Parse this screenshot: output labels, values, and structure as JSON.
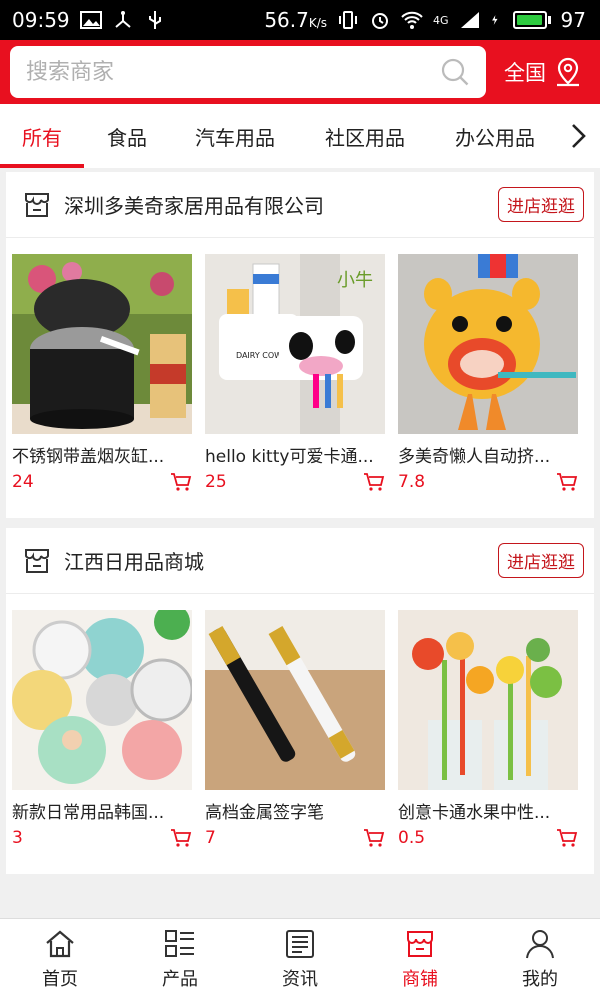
{
  "status_bar": {
    "time": "09:59",
    "speed": "56.7",
    "speed_unit": "K/s",
    "network": "4G",
    "battery": "97",
    "battery_level": 0.97
  },
  "search": {
    "placeholder": "搜索商家"
  },
  "region": {
    "label": "全国"
  },
  "tabs": [
    {
      "label": "所有",
      "active": true
    },
    {
      "label": "食品"
    },
    {
      "label": "汽车用品"
    },
    {
      "label": "社区用品"
    },
    {
      "label": "办公用品"
    }
  ],
  "shops": [
    {
      "name": "深圳多美奇家居用品有限公司",
      "enter_label": "进店逛逛",
      "products": [
        {
          "name": "不锈钢带盖烟灰缸...",
          "price": "24",
          "image": "ashtray"
        },
        {
          "name": "hello kitty可爱卡通...",
          "price": "25",
          "image": "toothbrush-holder",
          "image_text": {
            "brand": "DAIRY COW",
            "tag": "小牛"
          }
        },
        {
          "name": "多美奇懒人自动挤...",
          "price": "7.8",
          "image": "tiger-toothpaste-squeezer"
        }
      ]
    },
    {
      "name": "江西日用品商城",
      "enter_label": "进店逛逛",
      "products": [
        {
          "name": "新款日常用品韩国...",
          "price": "3",
          "image": "compact-mirrors"
        },
        {
          "name": "高档金属签字笔",
          "price": "7",
          "image": "metal-pens"
        },
        {
          "name": "创意卡通水果中性...",
          "price": "0.5",
          "image": "fruit-pens"
        }
      ]
    }
  ],
  "bottom_nav": [
    {
      "label": "首页",
      "icon": "home-icon"
    },
    {
      "label": "产品",
      "icon": "list-icon"
    },
    {
      "label": "资讯",
      "icon": "news-icon"
    },
    {
      "label": "商铺",
      "icon": "store-icon",
      "active": true
    },
    {
      "label": "我的",
      "icon": "user-icon"
    }
  ],
  "colors": {
    "brand": "#e8101f",
    "price": "#e8101f",
    "button_border": "#c4161c"
  }
}
